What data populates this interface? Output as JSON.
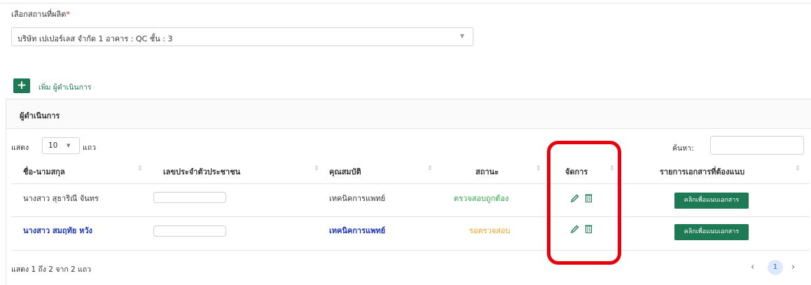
{
  "site": {
    "label": "เลือกสถานที่ผลิต",
    "required_mark": "*",
    "selected": "บริษัท เปเปอร์เลส จำกัด 1 อาคาร : QC ชั้น : 3",
    "caret": "▼"
  },
  "add": {
    "icon": "+",
    "label": "เพิ่ม ผู้ดำเนินการ"
  },
  "card": {
    "title": "ผู้ดำเนินการ"
  },
  "table_controls": {
    "show_label": "แสดง",
    "page_length": "10",
    "caret": "▼",
    "rows_suffix": "แถว",
    "search_label": "ค้นหา:",
    "search_value": ""
  },
  "table": {
    "columns": [
      "ชื่อ-นามสกุล",
      "เลขประจำตัวประชาชน",
      "คุณสมบัติ",
      "สถานะ",
      "จัดการ",
      "รายการเอกสารที่ต้องแนบ"
    ],
    "sort_glyph": "⇕",
    "rows": [
      {
        "name": "นางสาว สุธาริณี จันทร",
        "id_value": "",
        "qualification": "เทคนิคการแพทย์",
        "status": "ตรวจสอบถูกต้อง",
        "attach_label": "คลิกเพื่อแนบเอกสาร"
      },
      {
        "name": "นางสาว สมฤทัย หวัง",
        "id_value": "",
        "qualification": "เทคนิคการแพทย์",
        "status": "รอตรวจสอบ",
        "attach_label": "คลิกเพื่อแนบเอกสาร"
      }
    ]
  },
  "footer": {
    "info": "แสดง 1 ถึง 2 จาก 2 แถว",
    "prev": "‹",
    "current_page": "1",
    "next": "›"
  },
  "colors": {
    "accent_green": "#1d7a55",
    "status_ok": "#2ea84c",
    "status_wait": "#f0a020",
    "highlight_red": "#e8000b"
  },
  "icons": {
    "edit": "pencil-icon",
    "delete": "trash-icon"
  }
}
